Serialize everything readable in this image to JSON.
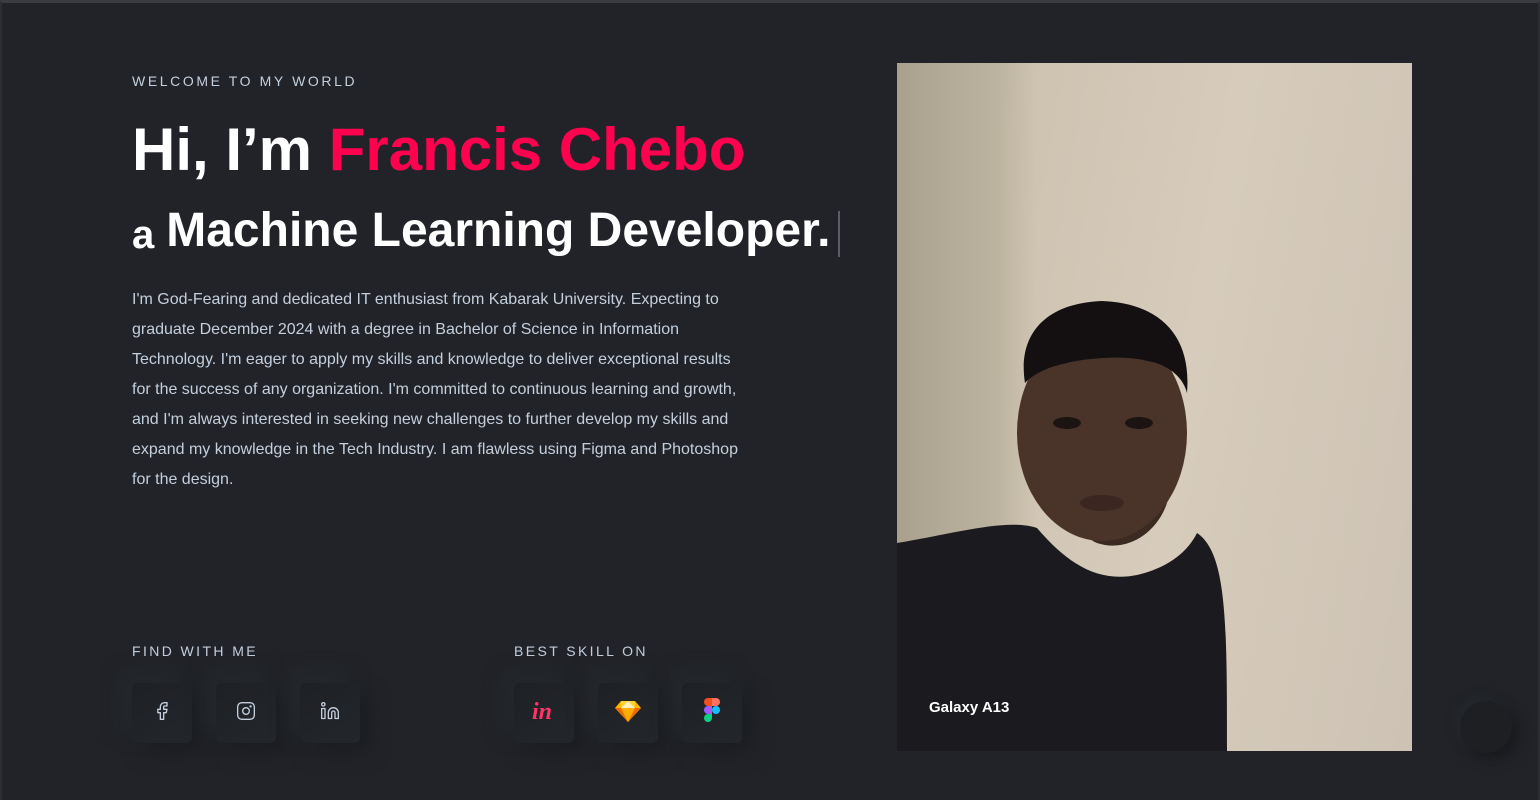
{
  "hero": {
    "kicker": "WELCOME TO MY WORLD",
    "greeting": "Hi, I’m ",
    "name": "Francis Chebo",
    "role_prefix": "a",
    "role": "Machine Learning Developer.",
    "bio": "I'm God-Fearing and dedicated IT enthusiast from Kabarak University. Expecting to graduate December 2024 with a degree in Bachelor of Science in Information Technology. I'm eager to apply my skills and knowledge to deliver exceptional results for the success of any organization. I'm committed to continuous learning and growth, and I'm always interested in seeking new challenges to further develop my skills and expand my knowledge in the Tech Industry. I am flawless using Figma and Photoshop for the design."
  },
  "social": {
    "title": "FIND WITH ME",
    "items": [
      {
        "icon": "facebook-icon"
      },
      {
        "icon": "instagram-icon"
      },
      {
        "icon": "linkedin-icon"
      }
    ]
  },
  "skills": {
    "title": "BEST SKILL ON",
    "items": [
      {
        "icon": "invision-icon"
      },
      {
        "icon": "sketch-icon"
      },
      {
        "icon": "figma-icon"
      }
    ]
  },
  "photo": {
    "caption": "Galaxy A13"
  },
  "colors": {
    "background": "#212328",
    "accent": "#ff014f",
    "body_text": "#c4cfde",
    "heading": "#ffffff"
  }
}
